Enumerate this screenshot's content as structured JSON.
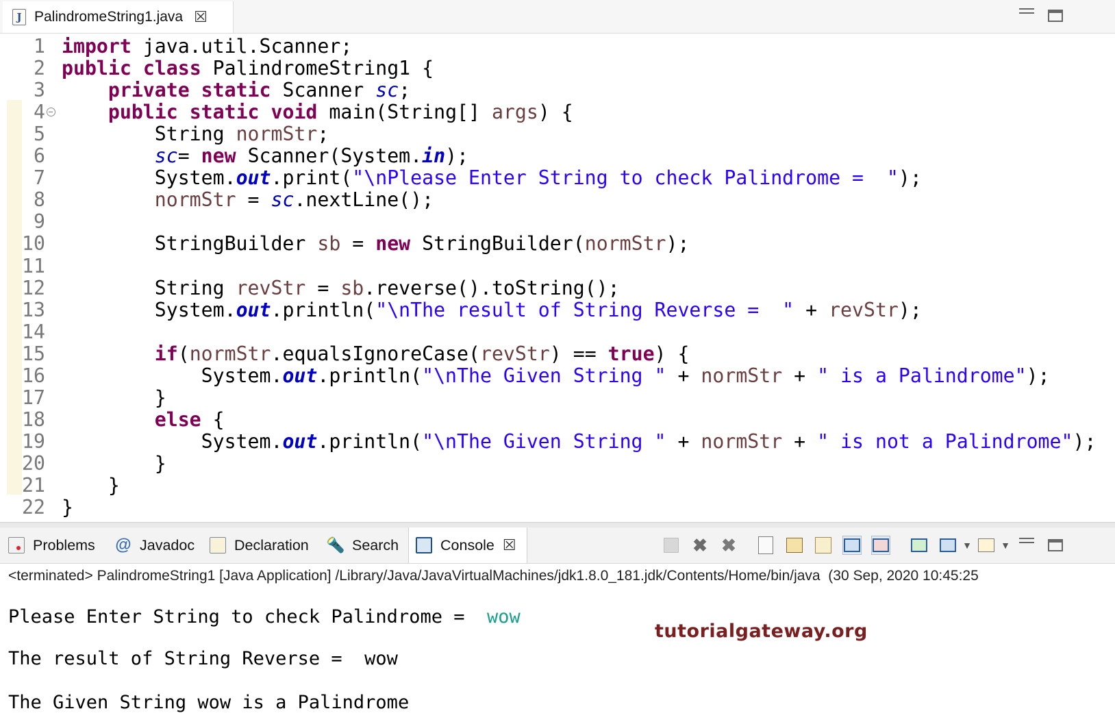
{
  "editor": {
    "tab_label": "PalindromeString1.java",
    "close_glyph": "☒",
    "file_icon_letter": "J"
  },
  "code_lines": [
    {
      "n": "1",
      "tokens": [
        [
          "kw",
          "import"
        ],
        [
          "t",
          " java.util.Scanner;"
        ]
      ]
    },
    {
      "n": "2",
      "tokens": [
        [
          "kw",
          "public"
        ],
        [
          "t",
          " "
        ],
        [
          "kw",
          "class"
        ],
        [
          "t",
          " PalindromeString1 {"
        ]
      ]
    },
    {
      "n": "3",
      "tokens": [
        [
          "t",
          "    "
        ],
        [
          "kw",
          "private"
        ],
        [
          "t",
          " "
        ],
        [
          "kw",
          "static"
        ],
        [
          "t",
          " Scanner "
        ],
        [
          "fld",
          "sc"
        ],
        [
          "t",
          ";"
        ]
      ]
    },
    {
      "n": "4",
      "fold": true,
      "tokens": [
        [
          "t",
          "    "
        ],
        [
          "kw",
          "public"
        ],
        [
          "t",
          " "
        ],
        [
          "kw",
          "static"
        ],
        [
          "t",
          " "
        ],
        [
          "kw",
          "void"
        ],
        [
          "t",
          " main(String[] "
        ],
        [
          "var",
          "args"
        ],
        [
          "t",
          ") {"
        ]
      ]
    },
    {
      "n": "5",
      "tokens": [
        [
          "t",
          "        String "
        ],
        [
          "var",
          "normStr"
        ],
        [
          "t",
          ";"
        ]
      ]
    },
    {
      "n": "6",
      "tokens": [
        [
          "t",
          "        "
        ],
        [
          "fld",
          "sc"
        ],
        [
          "t",
          "= "
        ],
        [
          "kw",
          "new"
        ],
        [
          "t",
          " Scanner(System."
        ],
        [
          "sfld",
          "in"
        ],
        [
          "t",
          ");"
        ]
      ]
    },
    {
      "n": "7",
      "tokens": [
        [
          "t",
          "        System."
        ],
        [
          "sfld",
          "out"
        ],
        [
          "t",
          ".print("
        ],
        [
          "str",
          "\"\\nPlease Enter String to check Palindrome =  \""
        ],
        [
          "t",
          ");"
        ]
      ]
    },
    {
      "n": "8",
      "tokens": [
        [
          "t",
          "        "
        ],
        [
          "var",
          "normStr"
        ],
        [
          "t",
          " = "
        ],
        [
          "fld",
          "sc"
        ],
        [
          "t",
          ".nextLine();"
        ]
      ]
    },
    {
      "n": "9",
      "tokens": []
    },
    {
      "n": "10",
      "tokens": [
        [
          "t",
          "        StringBuilder "
        ],
        [
          "var",
          "sb"
        ],
        [
          "t",
          " = "
        ],
        [
          "kw",
          "new"
        ],
        [
          "t",
          " StringBuilder("
        ],
        [
          "var",
          "normStr"
        ],
        [
          "t",
          ");"
        ]
      ]
    },
    {
      "n": "11",
      "tokens": []
    },
    {
      "n": "12",
      "tokens": [
        [
          "t",
          "        String "
        ],
        [
          "var",
          "revStr"
        ],
        [
          "t",
          " = "
        ],
        [
          "var",
          "sb"
        ],
        [
          "t",
          ".reverse().toString();"
        ]
      ]
    },
    {
      "n": "13",
      "tokens": [
        [
          "t",
          "        System."
        ],
        [
          "sfld",
          "out"
        ],
        [
          "t",
          ".println("
        ],
        [
          "str",
          "\"\\nThe result of String Reverse =  \""
        ],
        [
          "t",
          " + "
        ],
        [
          "var",
          "revStr"
        ],
        [
          "t",
          ");"
        ]
      ]
    },
    {
      "n": "14",
      "tokens": []
    },
    {
      "n": "15",
      "tokens": [
        [
          "t",
          "        "
        ],
        [
          "kw",
          "if"
        ],
        [
          "t",
          "("
        ],
        [
          "var",
          "normStr"
        ],
        [
          "t",
          ".equalsIgnoreCase("
        ],
        [
          "var",
          "revStr"
        ],
        [
          "t",
          ") == "
        ],
        [
          "kw",
          "true"
        ],
        [
          "t",
          ") {"
        ]
      ]
    },
    {
      "n": "16",
      "tokens": [
        [
          "t",
          "            System."
        ],
        [
          "sfld",
          "out"
        ],
        [
          "t",
          ".println("
        ],
        [
          "str",
          "\"\\nThe Given String \""
        ],
        [
          "t",
          " + "
        ],
        [
          "var",
          "normStr"
        ],
        [
          "t",
          " + "
        ],
        [
          "str",
          "\" is a Palindrome\""
        ],
        [
          "t",
          ");"
        ]
      ]
    },
    {
      "n": "17",
      "tokens": [
        [
          "t",
          "        }"
        ]
      ]
    },
    {
      "n": "18",
      "tokens": [
        [
          "t",
          "        "
        ],
        [
          "kw",
          "else"
        ],
        [
          "t",
          " {"
        ]
      ]
    },
    {
      "n": "19",
      "tokens": [
        [
          "t",
          "            System."
        ],
        [
          "sfld",
          "out"
        ],
        [
          "t",
          ".println("
        ],
        [
          "str",
          "\"\\nThe Given String \""
        ],
        [
          "t",
          " + "
        ],
        [
          "var",
          "normStr"
        ],
        [
          "t",
          " + "
        ],
        [
          "str",
          "\" is not a Palindrome\""
        ],
        [
          "t",
          ");"
        ]
      ]
    },
    {
      "n": "20",
      "tokens": [
        [
          "t",
          "        }"
        ]
      ]
    },
    {
      "n": "21",
      "tokens": [
        [
          "t",
          "    }"
        ]
      ]
    },
    {
      "n": "22",
      "tokens": [
        [
          "t",
          "}"
        ]
      ]
    }
  ],
  "panel": {
    "tabs": [
      {
        "label": "Problems",
        "icon": "problems-icon"
      },
      {
        "label": "Javadoc",
        "icon": "javadoc-icon",
        "glyph": "@"
      },
      {
        "label": "Declaration",
        "icon": "declaration-icon"
      },
      {
        "label": "Search",
        "icon": "search-icon",
        "glyph": "🔦"
      },
      {
        "label": "Console",
        "icon": "console-icon",
        "active": true
      }
    ],
    "console_close_glyph": "☒",
    "status": "<terminated> PalindromeString1 [Java Application] /Library/Java/JavaVirtualMachines/jdk1.8.0_181.jdk/Contents/Home/bin/java  (30 Sep, 2020 10:45:25",
    "output": {
      "line1_prompt": "Please Enter String to check Palindrome =  ",
      "line1_input": "wow",
      "line2": "The result of String Reverse =  wow",
      "line3": "The Given String wow is a Palindrome"
    }
  },
  "watermark": "tutorialgateway.org",
  "colors": {
    "keyword": "#7f0055",
    "string": "#2a00ff",
    "local_variable": "#6a3e3e",
    "field": "#0000c0",
    "user_input": "#1aa08c",
    "watermark": "#7a1f1f"
  }
}
